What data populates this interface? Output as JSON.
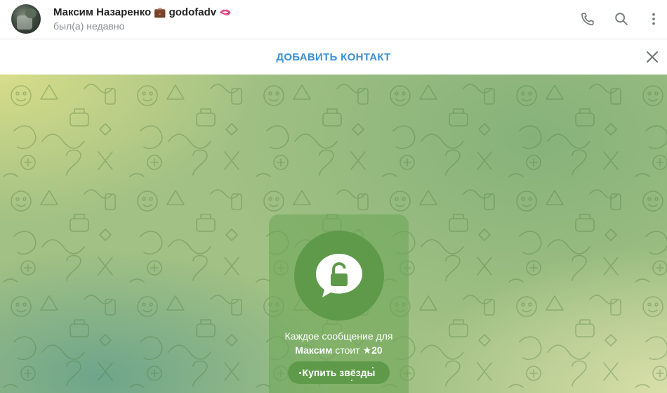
{
  "header": {
    "name": "Максим Назаренко",
    "name_emoji": "💼",
    "username": "godofadv",
    "username_emoji": "🫦",
    "status": "был(а) недавно",
    "icons": [
      "phone-icon",
      "search-icon",
      "more-vertical-icon"
    ]
  },
  "add_contact": {
    "label": "ДОБАВИТЬ КОНТАКТ",
    "close_icon": "close-icon"
  },
  "paid_message": {
    "line1": "Каждое сообщение для",
    "name": "Максим",
    "cost_text": "стоит",
    "star_icon": "★",
    "price": "20",
    "button_label": "Купить звёзды",
    "lock_icon": "lock-bubble-icon"
  },
  "colors": {
    "accent": "#3b8fd6",
    "card_bg": "#70a85a",
    "lock_bg": "#5f9a4a"
  }
}
